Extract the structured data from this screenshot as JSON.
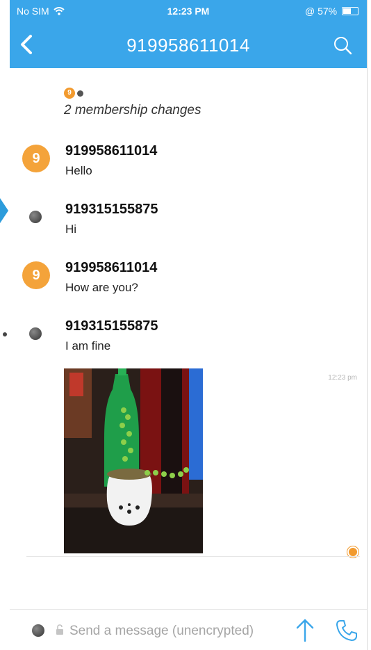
{
  "status_bar": {
    "carrier": "No SIM",
    "time": "12:23 PM",
    "battery": "57%",
    "battery_level": 0.57
  },
  "header": {
    "title": "919958611014",
    "back_icon": "chevron-left-icon",
    "search_icon": "search-icon"
  },
  "membership": {
    "avatar_letter": "9",
    "text": "2 membership changes"
  },
  "messages": [
    {
      "sender": "919958611014",
      "text": "Hello",
      "avatar_letter": "9"
    },
    {
      "sender": "919315155875",
      "text": "Hi"
    },
    {
      "sender": "919958611014",
      "text": "How are you?",
      "avatar_letter": "9"
    },
    {
      "sender": "919315155875",
      "text": "I am fine"
    }
  ],
  "image_message": {
    "timestamp": "12:23 pm"
  },
  "composer": {
    "placeholder": "Send a message (unencrypted)"
  },
  "colors": {
    "header_bg": "#3aa6ea",
    "avatar_orange": "#f4a33a"
  }
}
